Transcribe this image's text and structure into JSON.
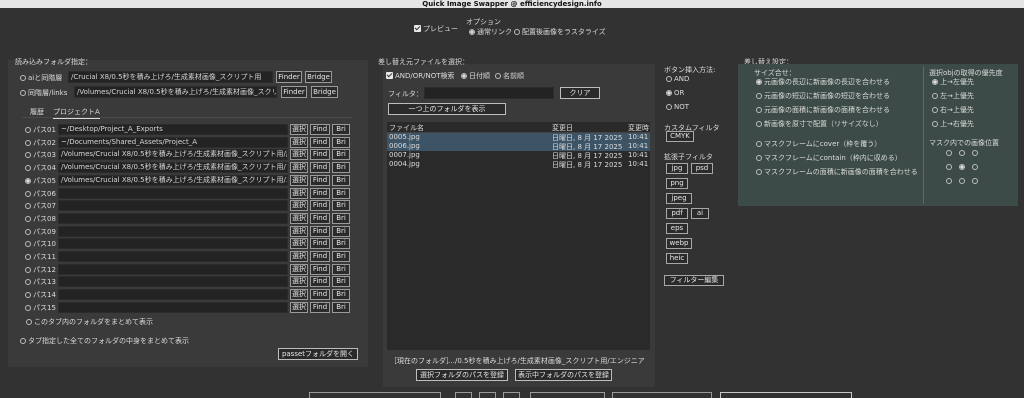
{
  "window": {
    "title": "Quick Image Swapper @ efficiencydesign.info"
  },
  "top": {
    "preview_label": "プレビュー",
    "options_label": "オプション",
    "opt_link": "通常リンク",
    "opt_raster": "配置後画像をラスタライズ"
  },
  "left": {
    "title": "読み込みフォルダ指定：",
    "ai_same": "aiと同階層",
    "ai_path": "/Crucial X8/0.5秒を積み上げろ/生成素材画像_スクリプト用",
    "links_same": "同階層/links",
    "links_path": "/Volumes/Crucial X8/0.5秒を積み上げろ/生成素材画像_スクリプ",
    "finder": "Finder",
    "bridge": "Bridge",
    "tab_history": "履歴",
    "tab_project": "プロジェクトA",
    "select": "選択",
    "find": "Find",
    "bri": "Bri",
    "paths": [
      {
        "label": "パス01",
        "value": "~/Desktop/Project_A_Exports"
      },
      {
        "label": "パス02",
        "value": "~/Documents/Shared_Assets/Project_A"
      },
      {
        "label": "パス03",
        "value": "/Volumes/Crucial X8/0.5秒を積み上げろ/生成素材画像_スクリプト用/風"
      },
      {
        "label": "パス04",
        "value": "/Volumes/Crucial X8/0.5秒を積み上げろ/生成素材画像_スクリプト用/フ"
      },
      {
        "label": "パス05",
        "value": "/Volumes/Crucial X8/0.5秒を積み上げろ/生成素材画像_スクリプト用/エ"
      },
      {
        "label": "パス06",
        "value": ""
      },
      {
        "label": "パス07",
        "value": ""
      },
      {
        "label": "パス08",
        "value": ""
      },
      {
        "label": "パス09",
        "value": ""
      },
      {
        "label": "パス10",
        "value": ""
      },
      {
        "label": "パス11",
        "value": ""
      },
      {
        "label": "パス12",
        "value": ""
      },
      {
        "label": "パス13",
        "value": ""
      },
      {
        "label": "パス14",
        "value": ""
      },
      {
        "label": "パス15",
        "value": ""
      }
    ],
    "tab_merge": "このタブ内のフォルダをまとめて表示",
    "all_merge": "タブ指定した全てのフォルダの中身をまとめて表示",
    "open_passet": "passetフォルダを開く"
  },
  "middle": {
    "title": "差し替え元ファイルを選択：",
    "andornot": "AND/OR/NOT検索",
    "sort_date": "日付順",
    "sort_name": "名前順",
    "filter_label": "フィルタ：",
    "clear": "クリア",
    "up_folder": "一つ上のフォルダを表示",
    "col_name": "ファイル名",
    "col_modified": "変更日",
    "col_modified2": "変更時",
    "files": [
      {
        "name": "0005.jpg",
        "date": "日曜日, 8 月 17 2025",
        "time": "10:41"
      },
      {
        "name": "0006.jpg",
        "date": "日曜日, 8 月 17 2025",
        "time": "10:41"
      },
      {
        "name": "0007.jpg",
        "date": "日曜日, 8 月 17 2025",
        "time": "10:41"
      },
      {
        "name": "0004.jpg",
        "date": "日曜日, 8 月 17 2025",
        "time": "10:41"
      }
    ],
    "current_folder_label": "［現在のフォルダ］",
    "current_folder": "…/0.5秒を積み上げろ/生成素材画像_スクリプト用/エンジニア",
    "reg_selected": "選択フォルダのパスを登録",
    "reg_current": "表示中フォルダのパスを登録"
  },
  "buttons_col": {
    "insert_method": "ボタン挿入方法:",
    "and": "AND",
    "or": "OR",
    "not": "NOT",
    "custom_filter": "カスタムフィルタ",
    "cmyk": "CMYK",
    "ext_filter": "拡張子フィルタ",
    "jpg": "jpg",
    "psd": "psd",
    "png": "png",
    "jpeg": "jpeg",
    "pdf": "pdf",
    "ai": "ai",
    "eps": "eps",
    "webp": "webp",
    "heic": "heic",
    "filter_edit": "フィルター編集"
  },
  "right": {
    "title": "差し替え設定：",
    "size_fit": "サイズ合せ：",
    "fit1": "元画像の長辺に新画像の長辺を合わせる",
    "fit2": "元画像の短辺に新画像の短辺を合わせる",
    "fit3": "元画像の面積に新画像の面積を合わせる",
    "fit4": "新画像を原寸で配置（リサイズなし）",
    "mask1": "マスクフレームにcover（枠を覆う）",
    "mask2": "マスクフレームにcontain（枠内に収める）",
    "mask3": "マスクフレームの面積に新画像の面積を合わせる",
    "priority_title": "選択objの取得の優先度",
    "p1": "上→左優先",
    "p2": "左→上優先",
    "p3": "右→上優先",
    "p4": "上→右優先",
    "mask_pos": "マスク内での画像位置"
  },
  "colors": {
    "selected_row": "#3d5466",
    "green_panel": "#3c4b47"
  }
}
